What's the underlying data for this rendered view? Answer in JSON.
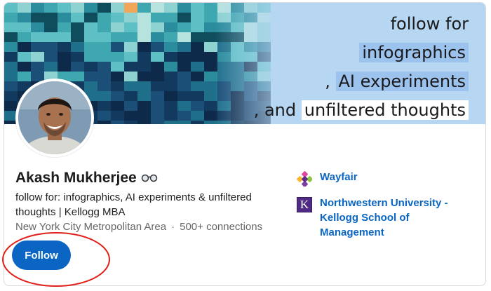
{
  "banner": {
    "line1": "follow for",
    "line2": "infographics",
    "line3_prefix": ",",
    "line3_highlight": "AI experiments",
    "line4_prefix": ", and",
    "line4_highlight": "unfiltered thoughts",
    "colors": {
      "background": "#b6d6f1",
      "highlight": "#9cc2ee"
    }
  },
  "profile": {
    "name": "Akash Mukherjee",
    "name_emoji_icon": "glasses-icon",
    "headline": "follow for: infographics, AI experiments & unfiltered thoughts | Kellogg MBA",
    "location": "New York City Metropolitan Area",
    "separator": "·",
    "connections": "500+ connections",
    "follow_label": "Follow"
  },
  "organizations": [
    {
      "name": "Wayfair",
      "logo": "wayfair-logo"
    },
    {
      "name": "Northwestern University - Kellogg School of Management",
      "logo": "kellogg-logo",
      "logo_letter": "K"
    }
  ],
  "colors": {
    "accent": "#0a66c2",
    "annotation_circle": "#e0201a"
  }
}
